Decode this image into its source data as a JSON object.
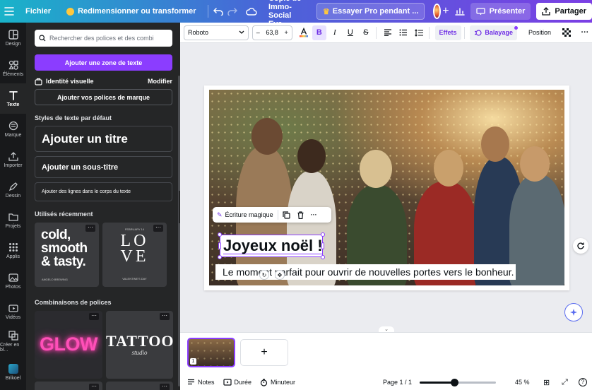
{
  "topbar": {
    "file": "Fichier",
    "resize": "Redimensionner ou transformer",
    "doc_title": "Copie de Immo-Social Eve...",
    "try_pro": "Essayer Pro pendant ...",
    "present": "Présenter",
    "share": "Partager"
  },
  "rail": [
    {
      "label": "Design",
      "icon": "layout-icon"
    },
    {
      "label": "Éléments",
      "icon": "shapes-icon"
    },
    {
      "label": "Texte",
      "icon": "text-icon"
    },
    {
      "label": "Marque",
      "icon": "brand-icon"
    },
    {
      "label": "Importer",
      "icon": "upload-icon"
    },
    {
      "label": "Dessin",
      "icon": "pen-icon"
    },
    {
      "label": "Projets",
      "icon": "folder-icon"
    },
    {
      "label": "Applis",
      "icon": "apps-icon"
    },
    {
      "label": "Photos",
      "icon": "image-icon"
    },
    {
      "label": "Vidéos",
      "icon": "video-icon"
    },
    {
      "label": "Créer en bl...",
      "icon": "bulk-create-icon"
    },
    {
      "label": "Brikoel",
      "icon": "user-app-icon"
    }
  ],
  "panel": {
    "search_placeholder": "Rechercher des polices et des combi",
    "add_textbox": "Ajouter une zone de texte",
    "brand_identity": "Identité visuelle",
    "modify": "Modifier",
    "add_brand_fonts": "Ajouter vos polices de marque",
    "default_styles_title": "Styles de texte par défaut",
    "add_title": "Ajouter un titre",
    "add_subtitle": "Ajouter un sous-titre",
    "add_body": "Ajouter des lignes dans le corps du texte",
    "recent_title": "Utilisés récemment",
    "recent": [
      {
        "line1": "cold,",
        "line2": "smooth",
        "line3": "& tasty.",
        "caption": "ANGELO BREWING"
      },
      {
        "top": "FEBRUARY 14",
        "line1": "LO",
        "line2": "VE",
        "bottom": "VALENTINE'S DAY"
      }
    ],
    "combos_title": "Combinaisons de polices",
    "combos": [
      {
        "text": "GLOW"
      },
      {
        "text": "TATTOO",
        "sub": "studio"
      }
    ]
  },
  "toolbar": {
    "font": "Roboto",
    "minus": "–",
    "size": "63,8",
    "plus": "+",
    "effects": "Effets",
    "sweep": "Balayage",
    "position": "Position"
  },
  "canvas": {
    "magic_write": "Écriture magique",
    "title_text": "Joyeux noël !",
    "subtitle_text": "Le moment parfait pour ouvrir de nouvelles portes vers le bonheur."
  },
  "pages": {
    "thumb_number": "1",
    "add": "+"
  },
  "footer": {
    "notes": "Notes",
    "duration": "Durée",
    "timer": "Minuteur",
    "page": "Page 1 / 1",
    "zoom": "45 %",
    "zoom_level": 0.45
  }
}
